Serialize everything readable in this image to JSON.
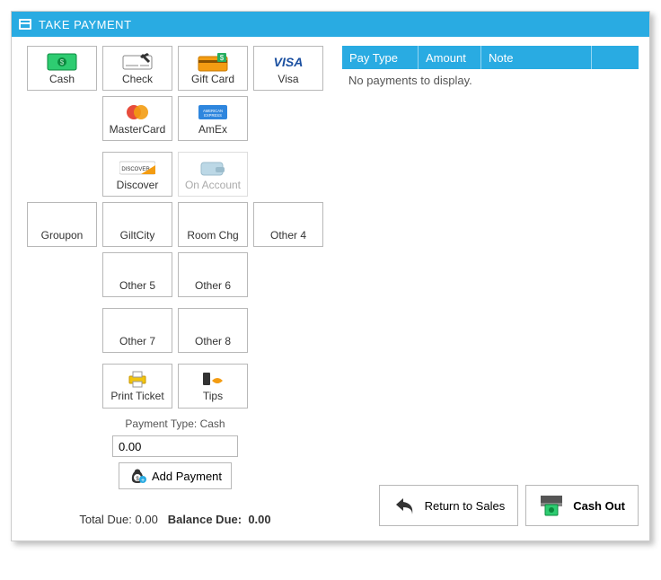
{
  "window": {
    "title": "TAKE PAYMENT"
  },
  "payment_buttons": {
    "cash": "Cash",
    "check": "Check",
    "giftcard": "Gift Card",
    "visa": "Visa",
    "mastercard": "MasterCard",
    "amex": "AmEx",
    "discover": "Discover",
    "on_account": "On Account",
    "groupon": "Groupon",
    "giltcity": "GiltCity",
    "roomchg": "Room Chg",
    "other4": "Other 4",
    "other5": "Other 5",
    "other6": "Other 6",
    "other7": "Other 7",
    "other8": "Other 8"
  },
  "actions": {
    "print_ticket": "Print Ticket",
    "tips": "Tips",
    "add_payment": "Add Payment",
    "return_to_sales": "Return to Sales",
    "cash_out": "Cash Out"
  },
  "payment_type": {
    "label": "Payment Type: Cash",
    "amount_value": "0.00"
  },
  "totals": {
    "total_due_label": "Total Due:",
    "total_due_value": "0.00",
    "balance_due_label": "Balance Due:",
    "balance_due_value": "0.00"
  },
  "table": {
    "headers": {
      "paytype": "Pay Type",
      "amount": "Amount",
      "note": "Note"
    },
    "empty_text": "No payments to display."
  }
}
